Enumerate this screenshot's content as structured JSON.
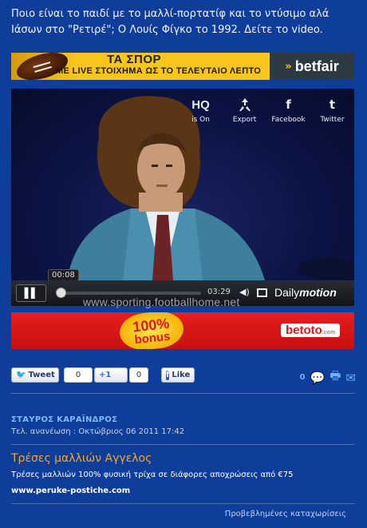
{
  "intro_text": "Ποιο είναι το παιδί με το μαλλί-πορτατίφ και το ντύσιμο αλά Ιάσων στο \"Ρετιρέ\"; Ο Λουίς Φίγκο το 1992. Δείτε το video.",
  "banner_top": {
    "title": "ΤΑ ΣΠΟΡ",
    "subtitle": "ΜΕ LIVE ΣΤΟΙΧΗΜΑ ΩΣ ΤΟ ΤΕΛΕΥΤΑΙΟ ΛΕΠΤΟ",
    "brand": "betfair",
    "brand_icon": "double-arrow-icon"
  },
  "video": {
    "controls": [
      {
        "icon": "hq-icon",
        "label_top": "HQ",
        "label": "is On"
      },
      {
        "icon": "export-icon",
        "label": "Export"
      },
      {
        "icon": "facebook-icon",
        "label": "Facebook"
      },
      {
        "icon": "twitter-icon",
        "label": "Twitter"
      }
    ],
    "current_time": "00:08",
    "duration": "03:29",
    "progress": 0.04,
    "brand": "Daily",
    "brand_em": "motion",
    "watermark": "www.sporting.footballhome.net"
  },
  "banner_bottom": {
    "bonus_big": "100%",
    "bonus_small": "bonus",
    "brand": "betoto",
    "brand_suffix": ".com"
  },
  "social": {
    "tweet_label": "Tweet",
    "tweet_count": "0",
    "plusone_label": "+1",
    "plusone_count": "0",
    "like_label": "Like",
    "comment_count": "0"
  },
  "article": {
    "author": "ΣΤΑΥΡΟΣ ΚΑΡΑΪΝΔΡΟΣ",
    "updated": "Τελ. ανανέωση : Οκτώβριος 06 2011 17:42"
  },
  "sponsored": {
    "title": "Τρέσες μαλλιών Αγγελος",
    "description": "Τρέσες μαλλιών 100% φυσική τρίχα σε διάφορες αποχρώσεις από €75",
    "link": "www.peruke-postiche.com",
    "footer": "Προβεβλημένες καταχωρίσεις"
  },
  "colors": {
    "page_bg": "#0e3d9a",
    "author": "#7fbaf2",
    "ad_title": "#f5a623",
    "betfair_yellow": "#f6c21a",
    "betoto_red": "#e61e1e"
  }
}
